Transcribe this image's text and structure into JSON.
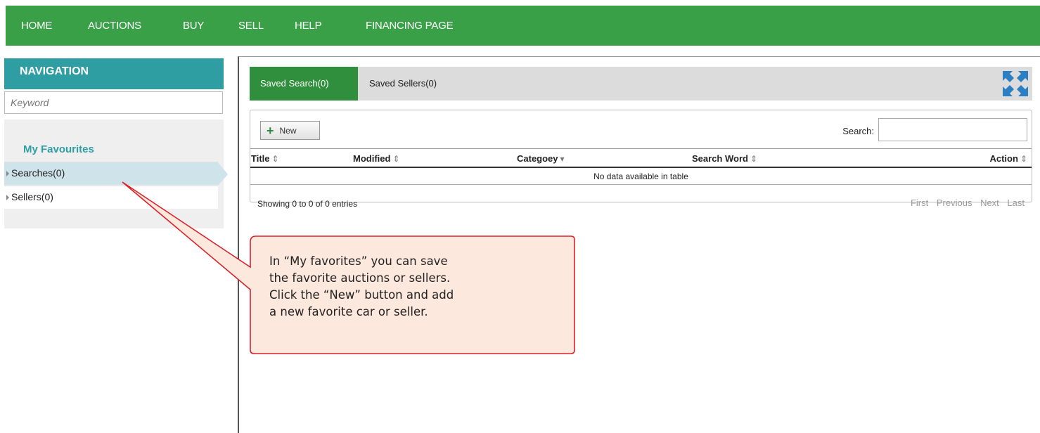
{
  "topnav": {
    "items": [
      "HOME",
      "AUCTIONS",
      "BUY",
      "SELL",
      "HELP",
      "FINANCING PAGE"
    ]
  },
  "sidebar": {
    "header": "NAVIGATION",
    "search_placeholder": "Keyword",
    "favourites_title": "My Favourites",
    "items": [
      {
        "label": "Searches(0)",
        "active": true
      },
      {
        "label": "Sellers(0)",
        "active": false
      }
    ]
  },
  "main": {
    "tabs": [
      {
        "label": "Saved Search(0)",
        "active": true
      },
      {
        "label": "Saved Sellers(0)",
        "active": false
      }
    ],
    "new_button": "New",
    "search_label": "Search:",
    "columns": [
      "Title",
      "Modified",
      "Categoey",
      "Search Word",
      "Action"
    ],
    "empty_text": "No data available in table",
    "info_text": "Showing 0 to 0 of 0 entries",
    "pager": [
      "First",
      "Previous",
      "Next",
      "Last"
    ]
  },
  "callout": {
    "lines": [
      "In “My favorites” you can save",
      "the favorite auctions or sellers.",
      "Click the “New” button and add",
      "a new favorite car or seller."
    ]
  },
  "colors": {
    "nav_green": "#3aa048",
    "teal": "#2e9ea3",
    "tab_green": "#2f8f3c",
    "callout_border": "#d9222a",
    "callout_fill": "#fde8dd",
    "expand_icon": "#2b7fc2"
  },
  "icons": {
    "expand": "expand-arrows-icon",
    "new": "plus-icon",
    "sort": "sort-arrows-icon",
    "tree": "triangle-right-icon"
  }
}
